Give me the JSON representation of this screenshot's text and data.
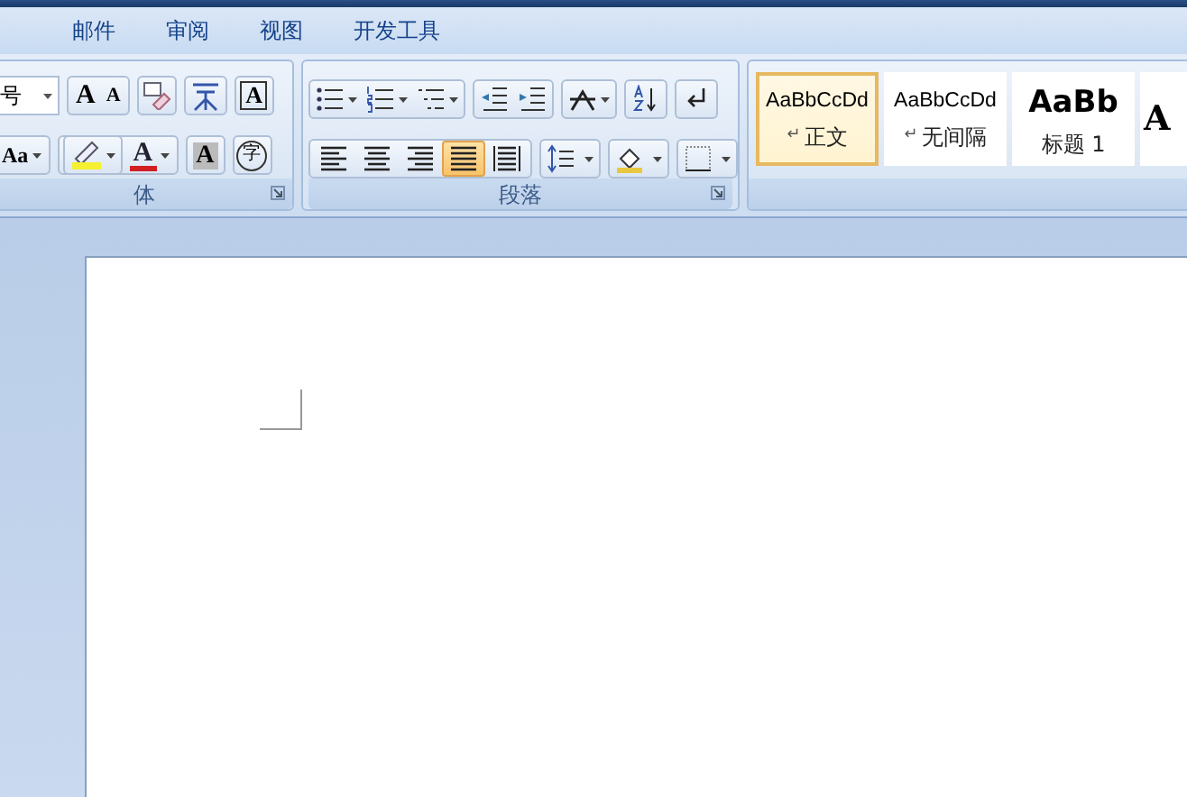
{
  "tabs": [
    {
      "label": "邮件",
      "selected": false
    },
    {
      "label": "审阅",
      "selected": false
    },
    {
      "label": "视图",
      "selected": false
    },
    {
      "label": "开发工具",
      "selected": false
    }
  ],
  "font_group": {
    "label": "体",
    "size_field": {
      "value": "号"
    },
    "row1": [
      {
        "kind": "grow",
        "glyph": "A"
      },
      {
        "kind": "shrink",
        "glyph": "A"
      },
      {
        "kind": "clear"
      },
      {
        "kind": "phonetic"
      },
      {
        "kind": "border",
        "glyph": "A"
      }
    ],
    "row2": [
      {
        "kind": "case",
        "glyph": "Aa"
      },
      {
        "kind": "highlight"
      },
      {
        "kind": "color",
        "glyph": "A"
      },
      {
        "kind": "shading",
        "glyph": "A"
      },
      {
        "kind": "enclosed",
        "glyph": "字"
      }
    ]
  },
  "paragraph_group": {
    "label": "段落",
    "row1": [
      {
        "kind": "bullets"
      },
      {
        "kind": "numbering"
      },
      {
        "kind": "multilevel"
      },
      {
        "kind": "outdent"
      },
      {
        "kind": "indent"
      },
      {
        "kind": "asian-layout"
      },
      {
        "kind": "sort"
      },
      {
        "kind": "marks"
      }
    ],
    "alignment": [
      {
        "kind": "left",
        "selected": false
      },
      {
        "kind": "center",
        "selected": false
      },
      {
        "kind": "right",
        "selected": false
      },
      {
        "kind": "justify",
        "selected": true
      },
      {
        "kind": "distributed",
        "selected": false
      }
    ],
    "row2": [
      {
        "kind": "line-spacing"
      },
      {
        "kind": "fill"
      },
      {
        "kind": "borders"
      }
    ]
  },
  "styles": [
    {
      "kind": "body",
      "preview": "AaBbCcDd",
      "mark": "↵",
      "name": "正文",
      "selected": true
    },
    {
      "kind": "body",
      "preview": "AaBbCcDd",
      "mark": "↵",
      "name": "无间隔",
      "selected": false
    },
    {
      "kind": "heading",
      "preview": "AaBb",
      "name": "标题 1",
      "selected": false
    },
    {
      "kind": "serif",
      "preview": "A",
      "selected": false
    }
  ]
}
